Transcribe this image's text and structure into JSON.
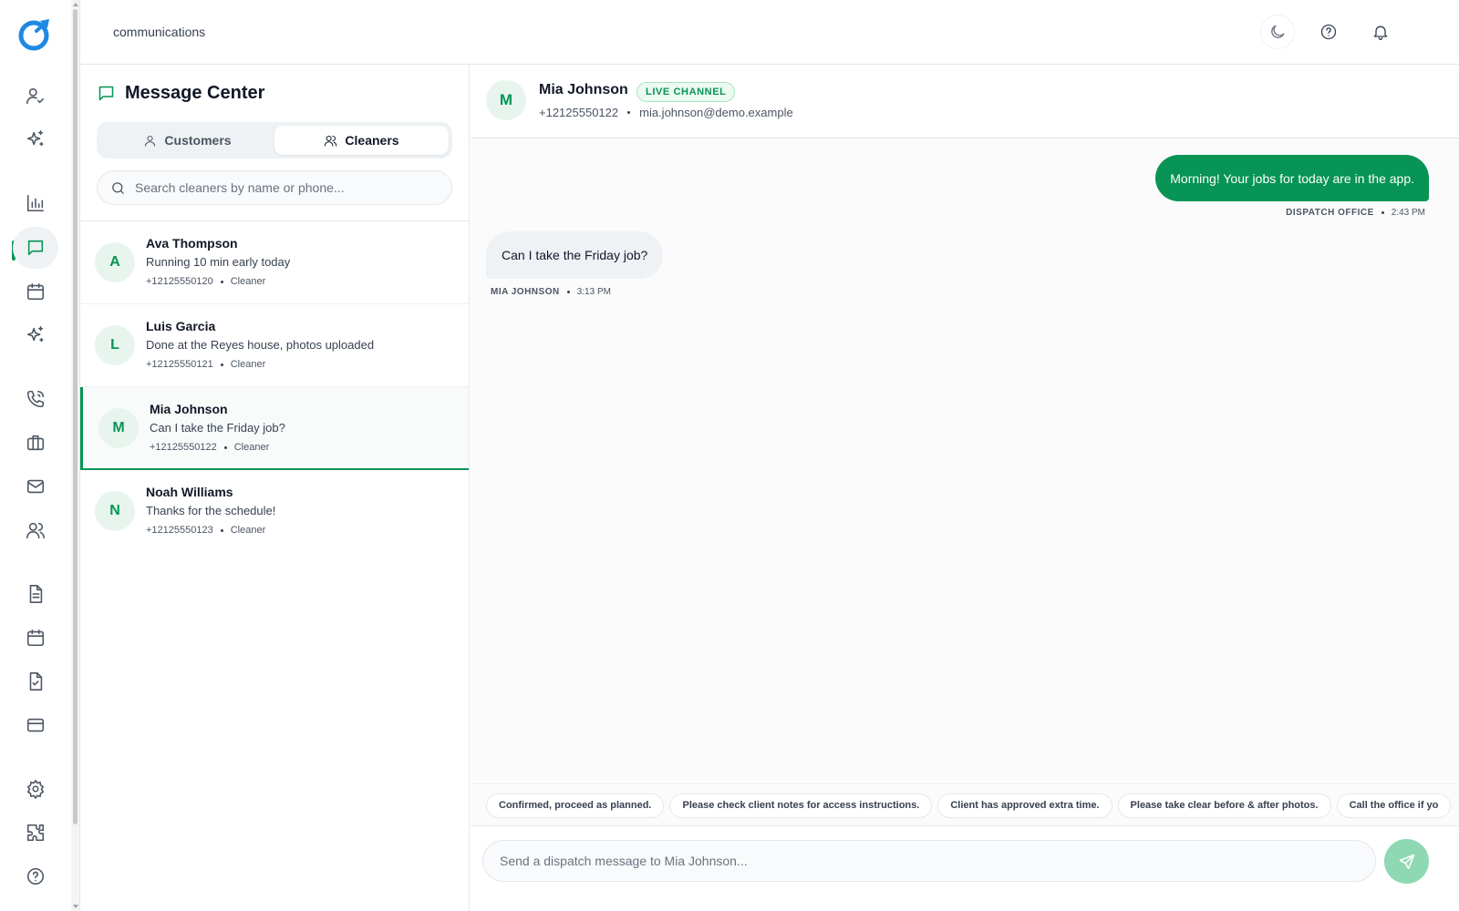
{
  "app": {
    "breadcrumb": "communications",
    "accent": "#079455"
  },
  "rail": {
    "items": [
      {
        "icon": "user-check-icon"
      },
      {
        "icon": "sparkles-icon"
      },
      {
        "icon": "bar-chart-icon"
      },
      {
        "icon": "message-icon",
        "active": true
      },
      {
        "icon": "calendar-icon"
      },
      {
        "icon": "sparkles-icon"
      },
      {
        "icon": "phone-icon"
      },
      {
        "icon": "briefcase-icon"
      },
      {
        "icon": "mail-icon"
      },
      {
        "icon": "users-icon"
      },
      {
        "icon": "document-icon"
      },
      {
        "icon": "calendar-icon"
      },
      {
        "icon": "clipboard-check-icon"
      },
      {
        "icon": "credit-card-icon"
      },
      {
        "icon": "gear-icon"
      },
      {
        "icon": "puzzle-icon"
      },
      {
        "icon": "help-icon"
      }
    ]
  },
  "topbar": {
    "icons": [
      "moon-icon",
      "help-icon",
      "bell-icon"
    ]
  },
  "panel": {
    "title": "Message Center",
    "tabs": [
      {
        "label": "Customers",
        "active": false
      },
      {
        "label": "Cleaners",
        "active": true
      }
    ],
    "search_placeholder": "Search cleaners by name or phone...",
    "contacts": [
      {
        "initial": "A",
        "name": "Ava Thompson",
        "last_message": "Running 10 min early today",
        "phone": "+12125550120",
        "role": "Cleaner",
        "selected": false
      },
      {
        "initial": "L",
        "name": "Luis Garcia",
        "last_message": "Done at the Reyes house, photos uploaded",
        "phone": "+12125550121",
        "role": "Cleaner",
        "selected": false
      },
      {
        "initial": "M",
        "name": "Mia Johnson",
        "last_message": "Can I take the Friday job?",
        "phone": "+12125550122",
        "role": "Cleaner",
        "selected": true
      },
      {
        "initial": "N",
        "name": "Noah Williams",
        "last_message": "Thanks for the schedule!",
        "phone": "+12125550123",
        "role": "Cleaner",
        "selected": false
      }
    ]
  },
  "chat": {
    "initial": "M",
    "name": "Mia Johnson",
    "badge": "LIVE CHANNEL",
    "phone": "+12125550122",
    "email": "mia.johnson@demo.example",
    "messages": [
      {
        "direction": "out",
        "text": "Morning! Your jobs for today are in the app.",
        "sender": "DISPATCH OFFICE",
        "time": "2:43 PM"
      },
      {
        "direction": "in",
        "text": "Can I take the Friday job?",
        "sender": "MIA JOHNSON",
        "time": "3:13 PM"
      }
    ],
    "quick_replies": [
      "Confirmed, proceed as planned.",
      "Please check client notes for access instructions.",
      "Client has approved extra time.",
      "Please take clear before & after photos.",
      "Call the office if yo"
    ],
    "composer_placeholder": "Send a dispatch message to Mia Johnson..."
  }
}
